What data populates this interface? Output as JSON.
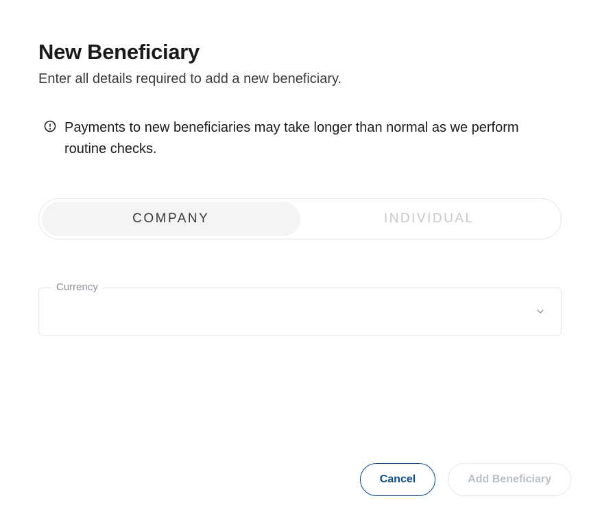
{
  "header": {
    "title": "New Beneficiary",
    "subtitle": "Enter all details required to add a new beneficiary."
  },
  "info": {
    "message": "Payments to new beneficiaries may take longer than normal as we perform routine checks."
  },
  "tabs": {
    "company": "COMPANY",
    "individual": "INDIVIDUAL"
  },
  "form": {
    "currency_label": "Currency",
    "currency_value": ""
  },
  "actions": {
    "cancel": "Cancel",
    "add": "Add Beneficiary"
  }
}
